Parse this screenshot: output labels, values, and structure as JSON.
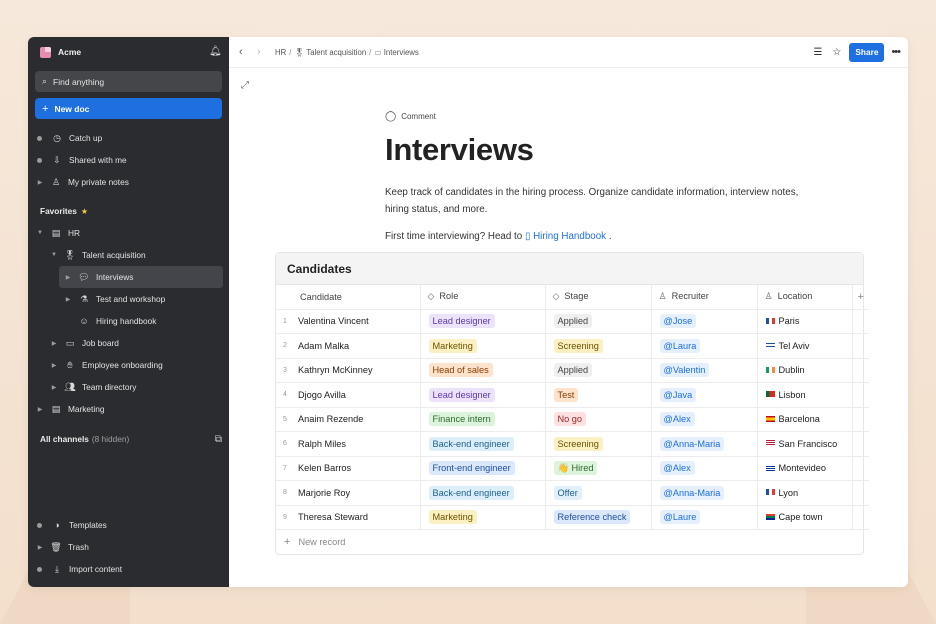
{
  "colors": {
    "accent": "#1e6fe0",
    "sidebar_bg": "#2b2c2f"
  },
  "workspace": {
    "name": "Acme"
  },
  "search": {
    "placeholder": "Find anything"
  },
  "new_doc": {
    "label": "New doc"
  },
  "nav": [
    {
      "label": "Catch up",
      "icon": "clock-icon"
    },
    {
      "label": "Shared with me",
      "icon": "inbox-icon"
    },
    {
      "label": "My private notes",
      "icon": "person-icon"
    }
  ],
  "favorites": {
    "label": "Favorites"
  },
  "tree": {
    "hr": "HR",
    "talent": "Talent acquisition",
    "interviews": "Interviews",
    "test_workshop": "Test and workshop",
    "hiring_handbook": "Hiring handbook",
    "job_board": "Job board",
    "onboarding": "Employee onboarding",
    "directory": "Team directory",
    "marketing": "Marketing"
  },
  "channels": {
    "label": "All channels",
    "hidden": "(8 hidden)"
  },
  "bottom_nav": [
    {
      "label": "Templates"
    },
    {
      "label": "Trash"
    },
    {
      "label": "Import content"
    }
  ],
  "breadcrumb": {
    "part1": "HR",
    "part2": "Talent acquisition",
    "part3": "Interviews"
  },
  "topbar": {
    "share_label": "Share"
  },
  "doc": {
    "comment_label": "Comment",
    "title": "Interviews",
    "description": "Keep track of candidates in the hiring process. Organize candidate information, interview notes, hiring status, and more.",
    "hint_prefix": "First time interviewing? Head to",
    "hint_link": "Hiring Handbook",
    "hint_suffix": "."
  },
  "table": {
    "title": "Candidates",
    "columns": [
      "Candidate",
      "Role",
      "Stage",
      "Recruiter",
      "Location"
    ],
    "new_record": "New record",
    "rows": [
      {
        "num": "1",
        "name": "Valentina Vincent",
        "role": "Lead designer",
        "role_color": "#ece3fb",
        "role_text": "#5a3aa8",
        "stage": "Applied",
        "stage_color": "#efefef",
        "stage_text": "#444",
        "recruiter": "@Jose",
        "location": "Paris",
        "flag": "fr"
      },
      {
        "num": "2",
        "name": "Adam Malka",
        "role": "Marketing",
        "role_color": "#fbf0c2",
        "role_text": "#6b5300",
        "stage": "Screening",
        "stage_color": "#fbf0c2",
        "stage_text": "#6b5300",
        "recruiter": "@Laura",
        "location": "Tel Aviv",
        "flag": "il"
      },
      {
        "num": "3",
        "name": "Kathryn McKinney",
        "role": "Head of sales",
        "role_color": "#fde2cc",
        "role_text": "#8a3d00",
        "stage": "Applied",
        "stage_color": "#efefef",
        "stage_text": "#444",
        "recruiter": "@Valentin",
        "location": "Dublin",
        "flag": "ie"
      },
      {
        "num": "4",
        "name": "Djogo Avilla",
        "role": "Lead designer",
        "role_color": "#ece3fb",
        "role_text": "#5a3aa8",
        "stage": "Test",
        "stage_color": "#fde2cc",
        "stage_text": "#8a3d00",
        "recruiter": "@Java",
        "location": "Lisbon",
        "flag": "pt"
      },
      {
        "num": "5",
        "name": "Anaim Rezende",
        "role": "Finance intern",
        "role_color": "#dcf3dc",
        "role_text": "#2e6b2e",
        "stage": "No go",
        "stage_color": "#fde0e0",
        "stage_text": "#a02828",
        "recruiter": "@Alex",
        "location": "Barcelona",
        "flag": "es"
      },
      {
        "num": "6",
        "name": "Ralph Miles",
        "role": "Back-end engineer",
        "role_color": "#dbeefa",
        "role_text": "#1f5f8b",
        "stage": "Screening",
        "stage_color": "#fbf0c2",
        "stage_text": "#6b5300",
        "recruiter": "@Anna-Maria",
        "location": "San Francisco",
        "flag": "us"
      },
      {
        "num": "7",
        "name": "Kelen Barros",
        "role": "Front-end engineer",
        "role_color": "#dbe7fb",
        "role_text": "#1f4f9b",
        "stage": "👋 Hired",
        "stage_color": "#dcf3dc",
        "stage_text": "#2e6b2e",
        "recruiter": "@Alex",
        "location": "Montevideo",
        "flag": "uy"
      },
      {
        "num": "8",
        "name": "Marjorie Roy",
        "role": "Back-end engineer",
        "role_color": "#dbeefa",
        "role_text": "#1f5f8b",
        "stage": "Offer",
        "stage_color": "#e2f0fb",
        "stage_text": "#1f5f8b",
        "recruiter": "@Anna-Maria",
        "location": "Lyon",
        "flag": "fr"
      },
      {
        "num": "9",
        "name": "Theresa Steward",
        "role": "Marketing",
        "role_color": "#fbf0c2",
        "role_text": "#6b5300",
        "stage": "Reference check",
        "stage_color": "#dbe7fb",
        "stage_text": "#1f4f9b",
        "recruiter": "@Laure",
        "location": "Cape town",
        "flag": "za"
      }
    ]
  }
}
